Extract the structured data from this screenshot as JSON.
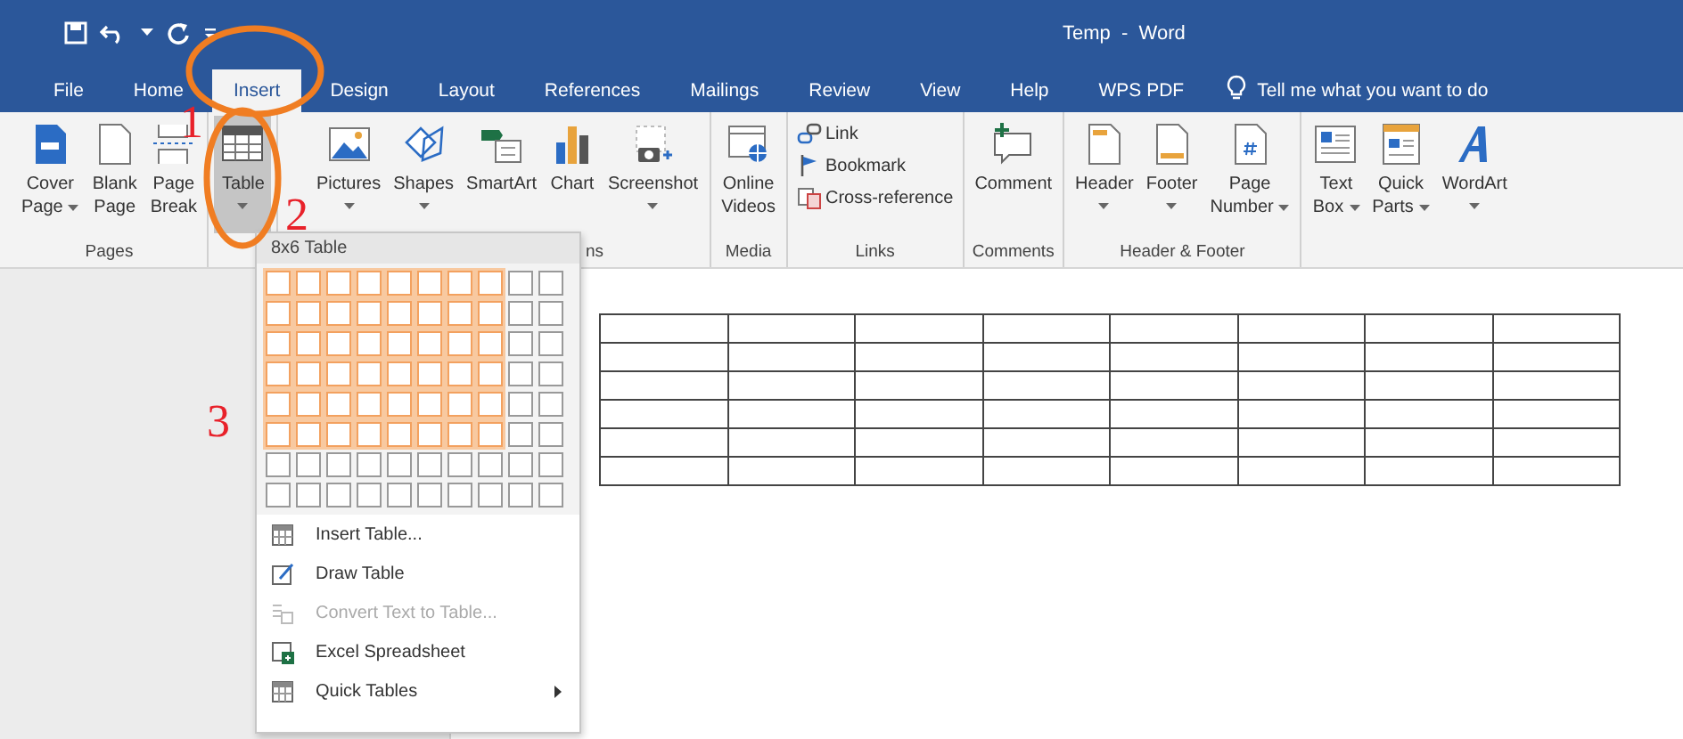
{
  "window": {
    "title": "Temp  -  Word"
  },
  "tabs": [
    {
      "label": "File",
      "selected": false
    },
    {
      "label": "Home",
      "selected": false
    },
    {
      "label": "Insert",
      "selected": true
    },
    {
      "label": "Design",
      "selected": false
    },
    {
      "label": "Layout",
      "selected": false
    },
    {
      "label": "References",
      "selected": false
    },
    {
      "label": "Mailings",
      "selected": false
    },
    {
      "label": "Review",
      "selected": false
    },
    {
      "label": "View",
      "selected": false
    },
    {
      "label": "Help",
      "selected": false
    },
    {
      "label": "WPS PDF",
      "selected": false
    }
  ],
  "tell_me": {
    "placeholder": "Tell me what you want to do"
  },
  "ribbon": {
    "groups": [
      {
        "label": "Pages",
        "kind": "large",
        "items": [
          {
            "kind": "cover",
            "lines": [
              "Cover",
              "Page"
            ],
            "dropdown": true,
            "selected": false
          },
          {
            "kind": "blank",
            "lines": [
              "Blank",
              "Page"
            ],
            "dropdown": false,
            "selected": false
          },
          {
            "kind": "break",
            "lines": [
              "Page",
              "Break"
            ],
            "dropdown": false,
            "selected": false
          }
        ]
      },
      {
        "kind": "large",
        "items": [
          {
            "kind": "table",
            "lines": [
              "Table"
            ],
            "dropdown": true,
            "selected": true
          }
        ]
      },
      {
        "label": "ns",
        "kind": "large",
        "items": [
          {
            "kind": "pictures",
            "lines": [
              "Pictures"
            ],
            "dropdown": true,
            "selected": false
          },
          {
            "kind": "shapes",
            "lines": [
              "Shapes"
            ],
            "dropdown": true,
            "selected": false
          },
          {
            "kind": "smartart",
            "lines": [
              "SmartArt"
            ],
            "dropdown": false,
            "selected": false
          },
          {
            "kind": "chart",
            "lines": [
              "Chart"
            ],
            "dropdown": false,
            "selected": false
          },
          {
            "kind": "screenshot",
            "lines": [
              "Screenshot"
            ],
            "dropdown": true,
            "selected": false
          }
        ]
      },
      {
        "label": "Media",
        "kind": "large",
        "items": [
          {
            "kind": "video",
            "lines": [
              "Online",
              "Videos"
            ],
            "dropdown": false,
            "selected": false
          }
        ]
      },
      {
        "label": "Links",
        "kind": "stacked",
        "items": [
          {
            "kind": "link",
            "lines": [
              "Link"
            ]
          },
          {
            "kind": "bookmark",
            "lines": [
              "Bookmark"
            ]
          },
          {
            "kind": "crossref",
            "lines": [
              "Cross-reference"
            ]
          }
        ]
      },
      {
        "label": "Comments",
        "kind": "large",
        "items": [
          {
            "kind": "comment",
            "lines": [
              "Comment"
            ],
            "dropdown": false,
            "selected": false
          }
        ]
      },
      {
        "label": "Header & Footer",
        "kind": "large",
        "items": [
          {
            "kind": "header",
            "lines": [
              "Header"
            ],
            "dropdown": true,
            "selected": false
          },
          {
            "kind": "footer",
            "lines": [
              "Footer"
            ],
            "dropdown": true,
            "selected": false
          },
          {
            "kind": "pagenum",
            "lines": [
              "Page",
              "Number"
            ],
            "dropdown": true,
            "selected": false
          }
        ]
      },
      {
        "kind": "large",
        "items": [
          {
            "kind": "textbox",
            "lines": [
              "Text",
              "Box"
            ],
            "dropdown": true,
            "selected": false
          },
          {
            "kind": "quickparts",
            "lines": [
              "Quick",
              "Parts"
            ],
            "dropdown": true,
            "selected": false
          },
          {
            "kind": "wordart",
            "lines": [
              "WordArt"
            ],
            "dropdown": true,
            "selected": false
          }
        ]
      }
    ]
  },
  "table_menu": {
    "grid_label": "8x6 Table",
    "grid": [
      {
        "cells": [
          {
            "selected": true
          },
          {
            "selected": true
          },
          {
            "selected": true
          },
          {
            "selected": true
          },
          {
            "selected": true
          },
          {
            "selected": true
          },
          {
            "selected": true
          },
          {
            "selected": true
          },
          {
            "selected": false
          },
          {
            "selected": false
          }
        ]
      },
      {
        "cells": [
          {
            "selected": true
          },
          {
            "selected": true
          },
          {
            "selected": true
          },
          {
            "selected": true
          },
          {
            "selected": true
          },
          {
            "selected": true
          },
          {
            "selected": true
          },
          {
            "selected": true
          },
          {
            "selected": false
          },
          {
            "selected": false
          }
        ]
      },
      {
        "cells": [
          {
            "selected": true
          },
          {
            "selected": true
          },
          {
            "selected": true
          },
          {
            "selected": true
          },
          {
            "selected": true
          },
          {
            "selected": true
          },
          {
            "selected": true
          },
          {
            "selected": true
          },
          {
            "selected": false
          },
          {
            "selected": false
          }
        ]
      },
      {
        "cells": [
          {
            "selected": true
          },
          {
            "selected": true
          },
          {
            "selected": true
          },
          {
            "selected": true
          },
          {
            "selected": true
          },
          {
            "selected": true
          },
          {
            "selected": true
          },
          {
            "selected": true
          },
          {
            "selected": false
          },
          {
            "selected": false
          }
        ]
      },
      {
        "cells": [
          {
            "selected": true
          },
          {
            "selected": true
          },
          {
            "selected": true
          },
          {
            "selected": true
          },
          {
            "selected": true
          },
          {
            "selected": true
          },
          {
            "selected": true
          },
          {
            "selected": true
          },
          {
            "selected": false
          },
          {
            "selected": false
          }
        ]
      },
      {
        "cells": [
          {
            "selected": true
          },
          {
            "selected": true
          },
          {
            "selected": true
          },
          {
            "selected": true
          },
          {
            "selected": true
          },
          {
            "selected": true
          },
          {
            "selected": true
          },
          {
            "selected": true
          },
          {
            "selected": false
          },
          {
            "selected": false
          }
        ]
      },
      {
        "cells": [
          {
            "selected": false
          },
          {
            "selected": false
          },
          {
            "selected": false
          },
          {
            "selected": false
          },
          {
            "selected": false
          },
          {
            "selected": false
          },
          {
            "selected": false
          },
          {
            "selected": false
          },
          {
            "selected": false
          },
          {
            "selected": false
          }
        ]
      },
      {
        "cells": [
          {
            "selected": false
          },
          {
            "selected": false
          },
          {
            "selected": false
          },
          {
            "selected": false
          },
          {
            "selected": false
          },
          {
            "selected": false
          },
          {
            "selected": false
          },
          {
            "selected": false
          },
          {
            "selected": false
          },
          {
            "selected": false
          }
        ]
      }
    ],
    "items": [
      {
        "kind": "insert",
        "label": "Insert Table...",
        "disabled": false,
        "submenu": false
      },
      {
        "kind": "draw",
        "label": "Draw Table",
        "disabled": false,
        "submenu": false
      },
      {
        "kind": "convert",
        "label": "Convert Text to Table...",
        "disabled": true,
        "submenu": false
      },
      {
        "kind": "excel",
        "label": "Excel Spreadsheet",
        "disabled": false,
        "submenu": false
      },
      {
        "kind": "quick",
        "label": "Quick Tables",
        "disabled": false,
        "submenu": true
      }
    ]
  },
  "document": {
    "table": {
      "rows": [
        {
          "cells": [
            {
              "kind": "empty"
            },
            {
              "kind": "empty"
            },
            {
              "kind": "empty"
            },
            {
              "kind": "empty"
            },
            {
              "kind": "empty"
            },
            {
              "kind": "empty"
            },
            {
              "kind": "empty"
            },
            {
              "kind": "empty"
            }
          ]
        },
        {
          "cells": [
            {
              "kind": "empty"
            },
            {
              "kind": "empty"
            },
            {
              "kind": "empty"
            },
            {
              "kind": "empty"
            },
            {
              "kind": "empty"
            },
            {
              "kind": "empty"
            },
            {
              "kind": "empty"
            },
            {
              "kind": "empty"
            }
          ]
        },
        {
          "cells": [
            {
              "kind": "empty"
            },
            {
              "kind": "empty"
            },
            {
              "kind": "empty"
            },
            {
              "kind": "empty"
            },
            {
              "kind": "empty"
            },
            {
              "kind": "empty"
            },
            {
              "kind": "empty"
            },
            {
              "kind": "empty"
            }
          ]
        },
        {
          "cells": [
            {
              "kind": "empty"
            },
            {
              "kind": "empty"
            },
            {
              "kind": "empty"
            },
            {
              "kind": "empty"
            },
            {
              "kind": "empty"
            },
            {
              "kind": "empty"
            },
            {
              "kind": "empty"
            },
            {
              "kind": "empty"
            }
          ]
        },
        {
          "cells": [
            {
              "kind": "empty"
            },
            {
              "kind": "empty"
            },
            {
              "kind": "empty"
            },
            {
              "kind": "empty"
            },
            {
              "kind": "empty"
            },
            {
              "kind": "empty"
            },
            {
              "kind": "empty"
            },
            {
              "kind": "empty"
            }
          ]
        },
        {
          "cells": [
            {
              "kind": "empty"
            },
            {
              "kind": "empty"
            },
            {
              "kind": "empty"
            },
            {
              "kind": "empty"
            },
            {
              "kind": "empty"
            },
            {
              "kind": "empty"
            },
            {
              "kind": "empty"
            },
            {
              "kind": "empty"
            }
          ]
        }
      ]
    }
  },
  "annotations": [
    {
      "kind": "ellipse"
    },
    {
      "kind": "ellipse"
    },
    {
      "kind": "number",
      "label": "1"
    },
    {
      "kind": "number",
      "label": "2"
    },
    {
      "kind": "number",
      "label": "3"
    }
  ]
}
